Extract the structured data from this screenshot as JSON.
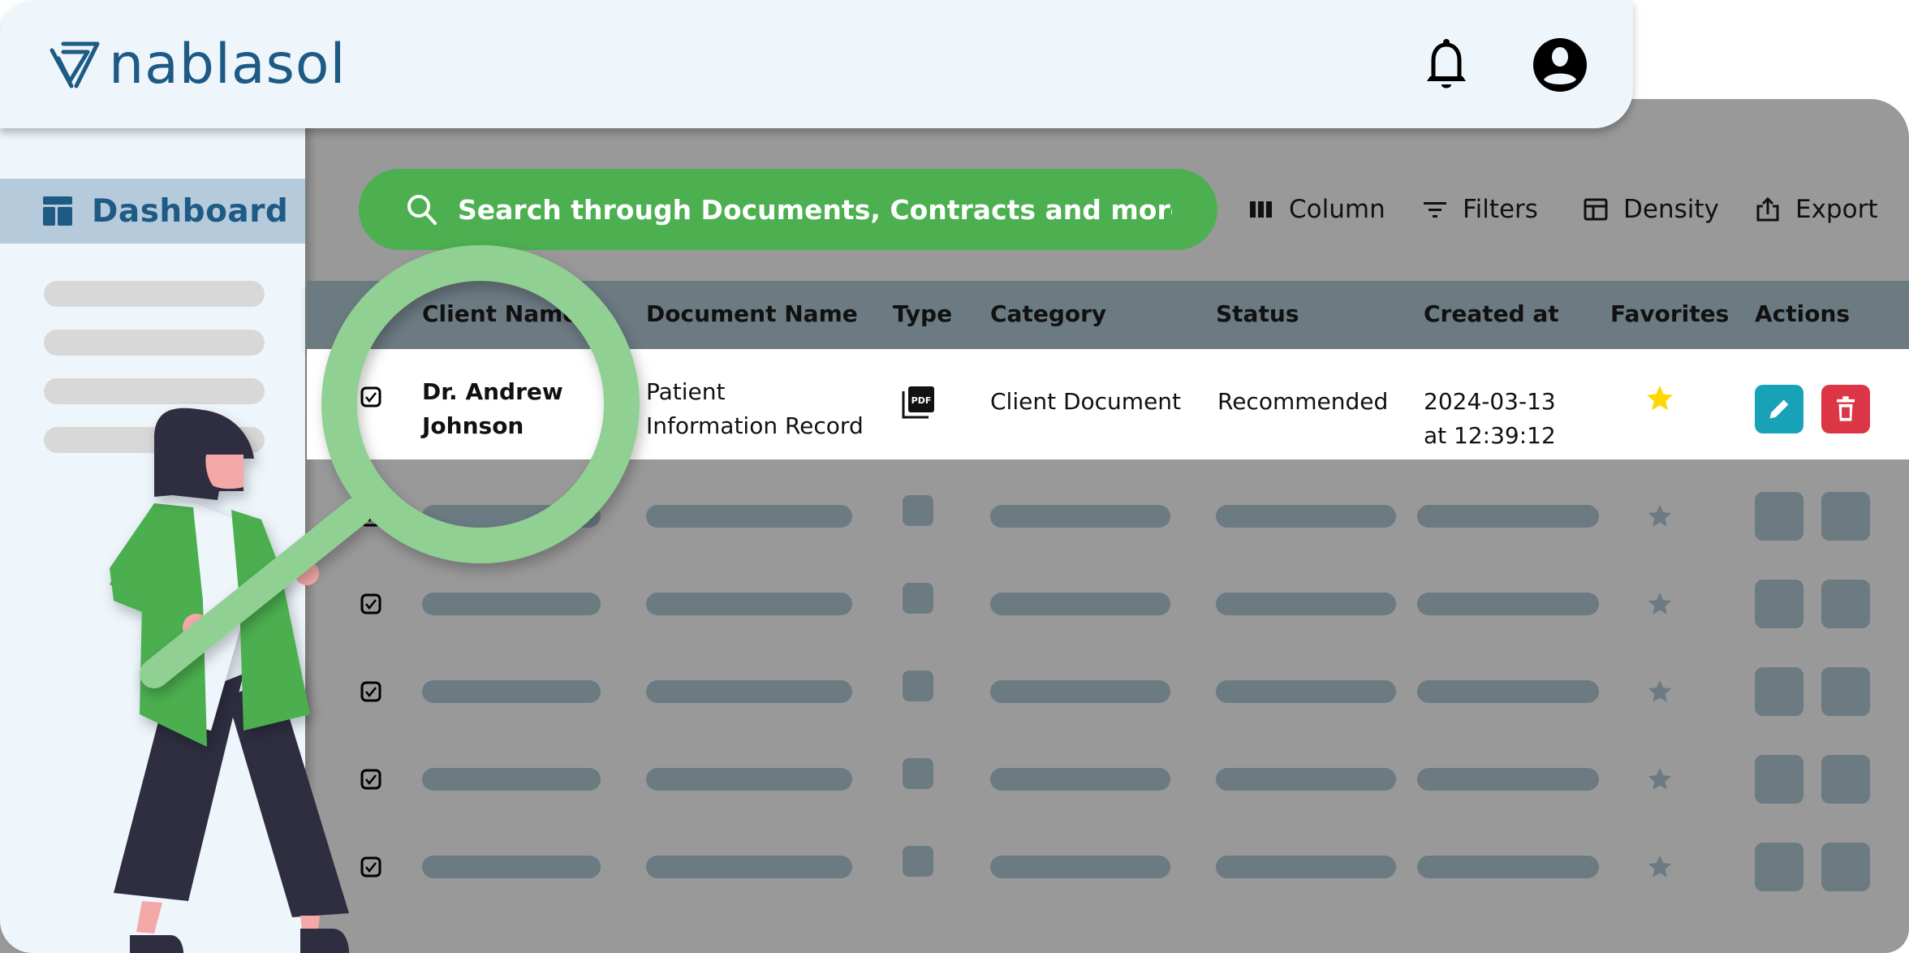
{
  "brand": {
    "name": "nablasol",
    "color": "#1d5a84",
    "accent": "#4caf50"
  },
  "header": {
    "icons": [
      "bell-icon",
      "account-circle-icon"
    ]
  },
  "sidebar": {
    "active_item": {
      "label": "Dashboard",
      "icon": "dashboard-icon"
    }
  },
  "search": {
    "placeholder": "Search through Documents, Contracts and more..",
    "value": ""
  },
  "toolbar": {
    "column_label": "Column",
    "filters_label": "Filters",
    "density_label": "Density",
    "export_label": "Export"
  },
  "table": {
    "columns": [
      "Client Name",
      "Document Name",
      "Type",
      "Category",
      "Status",
      "Created at",
      "Favorites",
      "Actions"
    ],
    "rows": [
      {
        "checked": true,
        "client_name_line1": "Dr. Andrew",
        "client_name_line2": "Johnson",
        "document_name_line1": "Patient",
        "document_name_line2": "Information Record",
        "type": "PDF",
        "category": "Client Document",
        "status": "Recommended",
        "created_date": "2024-03-13",
        "created_time": "at 12:39:12",
        "favorite": true
      }
    ],
    "placeholder_rows": 5
  },
  "colors": {
    "edit": "#17a2b8",
    "delete": "#dc3545",
    "star": "#ffd600"
  }
}
